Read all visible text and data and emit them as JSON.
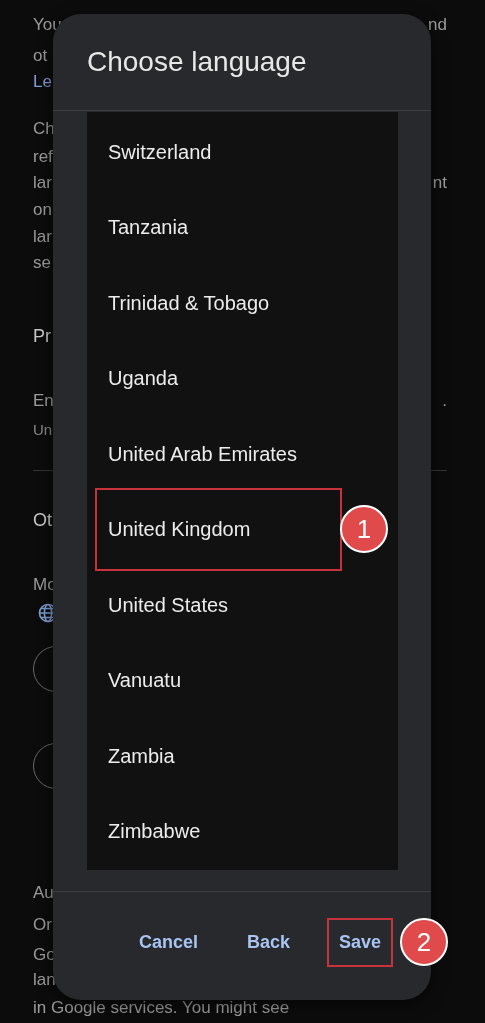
{
  "background": [
    {
      "kind": "text",
      "left": "You",
      "right": "nd"
    },
    {
      "kind": "text",
      "left": "ot"
    },
    {
      "kind": "link",
      "left": "Le"
    },
    {
      "kind": "text",
      "left": "Ch"
    },
    {
      "kind": "text",
      "left": "ref"
    },
    {
      "kind": "text",
      "left": "lar",
      "right": "nt"
    },
    {
      "kind": "text",
      "left": "on"
    },
    {
      "kind": "text",
      "left": "lar"
    },
    {
      "kind": "text",
      "left": "se"
    },
    {
      "kind": "heading",
      "left": "Pr"
    },
    {
      "kind": "text",
      "left": "En",
      "right": "."
    },
    {
      "kind": "sub",
      "left": "Un"
    },
    {
      "kind": "divider"
    },
    {
      "kind": "heading",
      "left": "Ot"
    },
    {
      "kind": "text",
      "left": "Mo"
    },
    {
      "kind": "globe"
    },
    {
      "kind": "button"
    },
    {
      "kind": "button"
    },
    {
      "kind": "text",
      "left": "Au"
    },
    {
      "kind": "text",
      "left": "Or"
    },
    {
      "kind": "text",
      "left": "Go"
    },
    {
      "kind": "text",
      "left": "lan"
    },
    {
      "kind": "text",
      "left": "in Google services. You might see"
    }
  ],
  "dialog": {
    "title": "Choose language",
    "items": [
      {
        "name": "Switzerland"
      },
      {
        "name": "Tanzania"
      },
      {
        "name": "Trinidad & Tobago"
      },
      {
        "name": "Uganda"
      },
      {
        "name": "United Arab Emirates"
      },
      {
        "name": "United Kingdom",
        "callout": "1"
      },
      {
        "name": "United States"
      },
      {
        "name": "Vanuatu"
      },
      {
        "name": "Zambia"
      },
      {
        "name": "Zimbabwe"
      }
    ],
    "buttons": [
      {
        "label": "Cancel"
      },
      {
        "label": "Back"
      },
      {
        "label": "Save",
        "callout": "2"
      }
    ]
  }
}
